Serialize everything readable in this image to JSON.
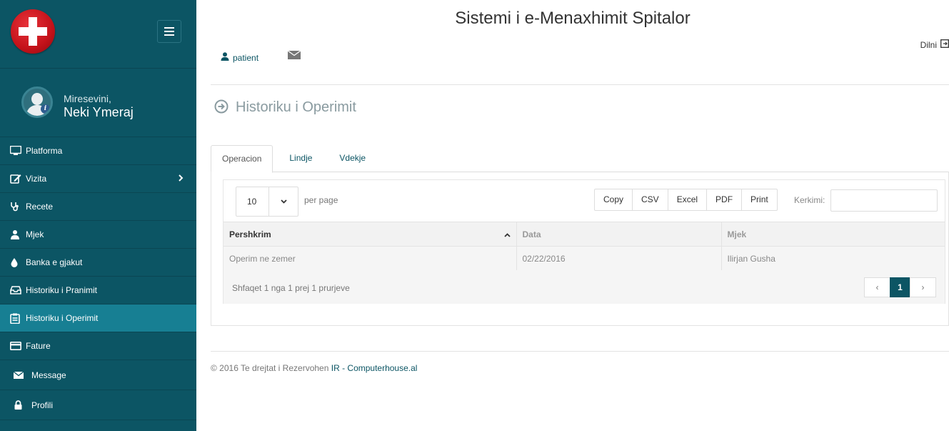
{
  "app": {
    "title": "Sistemi i e-Menaxhimit Spitalor"
  },
  "header": {
    "user_label": "patient",
    "logout_label": "Dilni"
  },
  "sidebar": {
    "welcome": "Miresevini,",
    "username": "Neki Ymeraj",
    "items": [
      {
        "label": "Platforma",
        "icon": "monitor-icon"
      },
      {
        "label": "Vizita",
        "icon": "edit-icon"
      },
      {
        "label": "Recete",
        "icon": "stethoscope-icon"
      },
      {
        "label": "Mjek",
        "icon": "doctor-icon"
      },
      {
        "label": "Banka e gjakut",
        "icon": "drop-icon"
      },
      {
        "label": "Historiku i Pranimit",
        "icon": "inbox-icon"
      },
      {
        "label": "Historiku i Operimit",
        "icon": "clipboard-icon"
      },
      {
        "label": "Fature",
        "icon": "credit-card-icon"
      },
      {
        "label": "Message",
        "icon": "envelope-icon"
      },
      {
        "label": "Profili",
        "icon": "lock-icon"
      }
    ],
    "active": "Historiku i Operimit"
  },
  "page": {
    "title": "Historiku i Operimit"
  },
  "tabs": [
    {
      "label": "Operacion"
    },
    {
      "label": "Lindje"
    },
    {
      "label": "Vdekje"
    }
  ],
  "table_controls": {
    "per_page_value": "10",
    "per_page_label": "per page",
    "buttons": [
      "Copy",
      "CSV",
      "Excel",
      "PDF",
      "Print"
    ],
    "search_label": "Kerkimi:",
    "search_value": ""
  },
  "table": {
    "columns": [
      "Pershkrim",
      "Data",
      "Mjek"
    ],
    "rows": [
      [
        "Operim ne zemer",
        "02/22/2016",
        "Ilirjan Gusha"
      ]
    ],
    "info": "Shfaqet 1 nga 1 prej 1 prurjeve",
    "pager": {
      "prev": "‹",
      "current": "1",
      "next": "›"
    }
  },
  "footer": {
    "text": "© 2016 Te drejtat i Rezervohen ",
    "link": "IR - Computerhouse.al"
  },
  "colors": {
    "sidebar": "#0c5564",
    "active": "#177f93",
    "accent": "#0c5564"
  }
}
